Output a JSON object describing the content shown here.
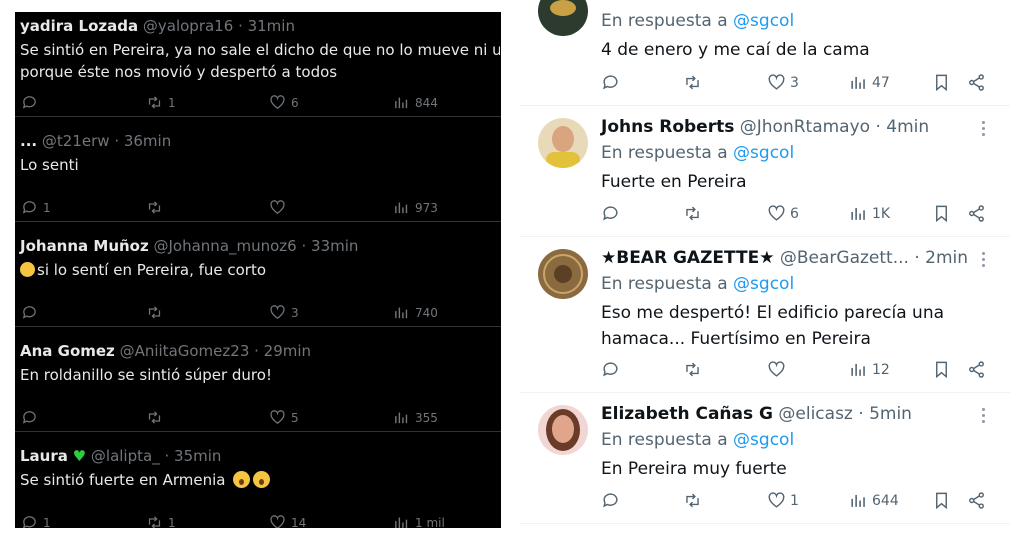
{
  "left_feed": [
    {
      "name": "yadira Lozada",
      "handle": "@yalopra16",
      "time": "· 31min",
      "text_line1": "Se sintió en Pereira, ya no sale el dicho de que no lo mueve ni un tem",
      "text_line2": "porque éste nos movió y despertó a todos",
      "retweets": "1",
      "likes": "6",
      "views": "844"
    },
    {
      "name": "...",
      "handle": "@t21erw",
      "time": "· 36min",
      "text_line1": "Lo senti",
      "replies": "1",
      "views": "973"
    },
    {
      "name": "Johanna Muñoz",
      "handle": "@Johanna_munoz6",
      "time": "· 33min",
      "text_line1": "si lo sentí en Pereira, fue corto",
      "likes": "3",
      "views": "740"
    },
    {
      "name": "Ana Gomez",
      "handle": "@AniitaGomez23",
      "time": "· 29min",
      "text_line1": "En roldanillo se sintió súper duro!",
      "likes": "5",
      "views": "355"
    },
    {
      "name": "Laura",
      "handle": "@lalipta_",
      "time": "· 35min",
      "text_line1": "Se sintió fuerte en Armenia",
      "replies": "1",
      "retweets": "1",
      "likes": "14",
      "views": "1 mil"
    }
  ],
  "right_feed": [
    {
      "reply_prefix": "En respuesta a",
      "reply_mention": "@sgcol",
      "text": "4 de enero y me caí de la cama",
      "likes": "3",
      "views": "47"
    },
    {
      "name": "Johns Roberts",
      "handle": "@JhonRtamayo",
      "time": "· 4min",
      "reply_prefix": "En respuesta a",
      "reply_mention": "@sgcol",
      "text": "Fuerte en Pereira",
      "likes": "6",
      "views": "1K"
    },
    {
      "name": "★BEAR GAZETTE★",
      "handle": "@BearGazett...",
      "time": "· 2min",
      "reply_prefix": "En respuesta a",
      "reply_mention": "@sgcol",
      "text_line1": "Eso me despertó! El edificio parecía una",
      "text_line2": "hamaca... Fuertísimo en Pereira",
      "views": "12"
    },
    {
      "name": "Elizabeth Cañas G",
      "handle": "@elicasz",
      "time": "· 5min",
      "reply_prefix": "En respuesta a",
      "reply_mention": "@sgcol",
      "text": "En Pereira muy fuerte",
      "likes": "1",
      "views": "644"
    }
  ]
}
